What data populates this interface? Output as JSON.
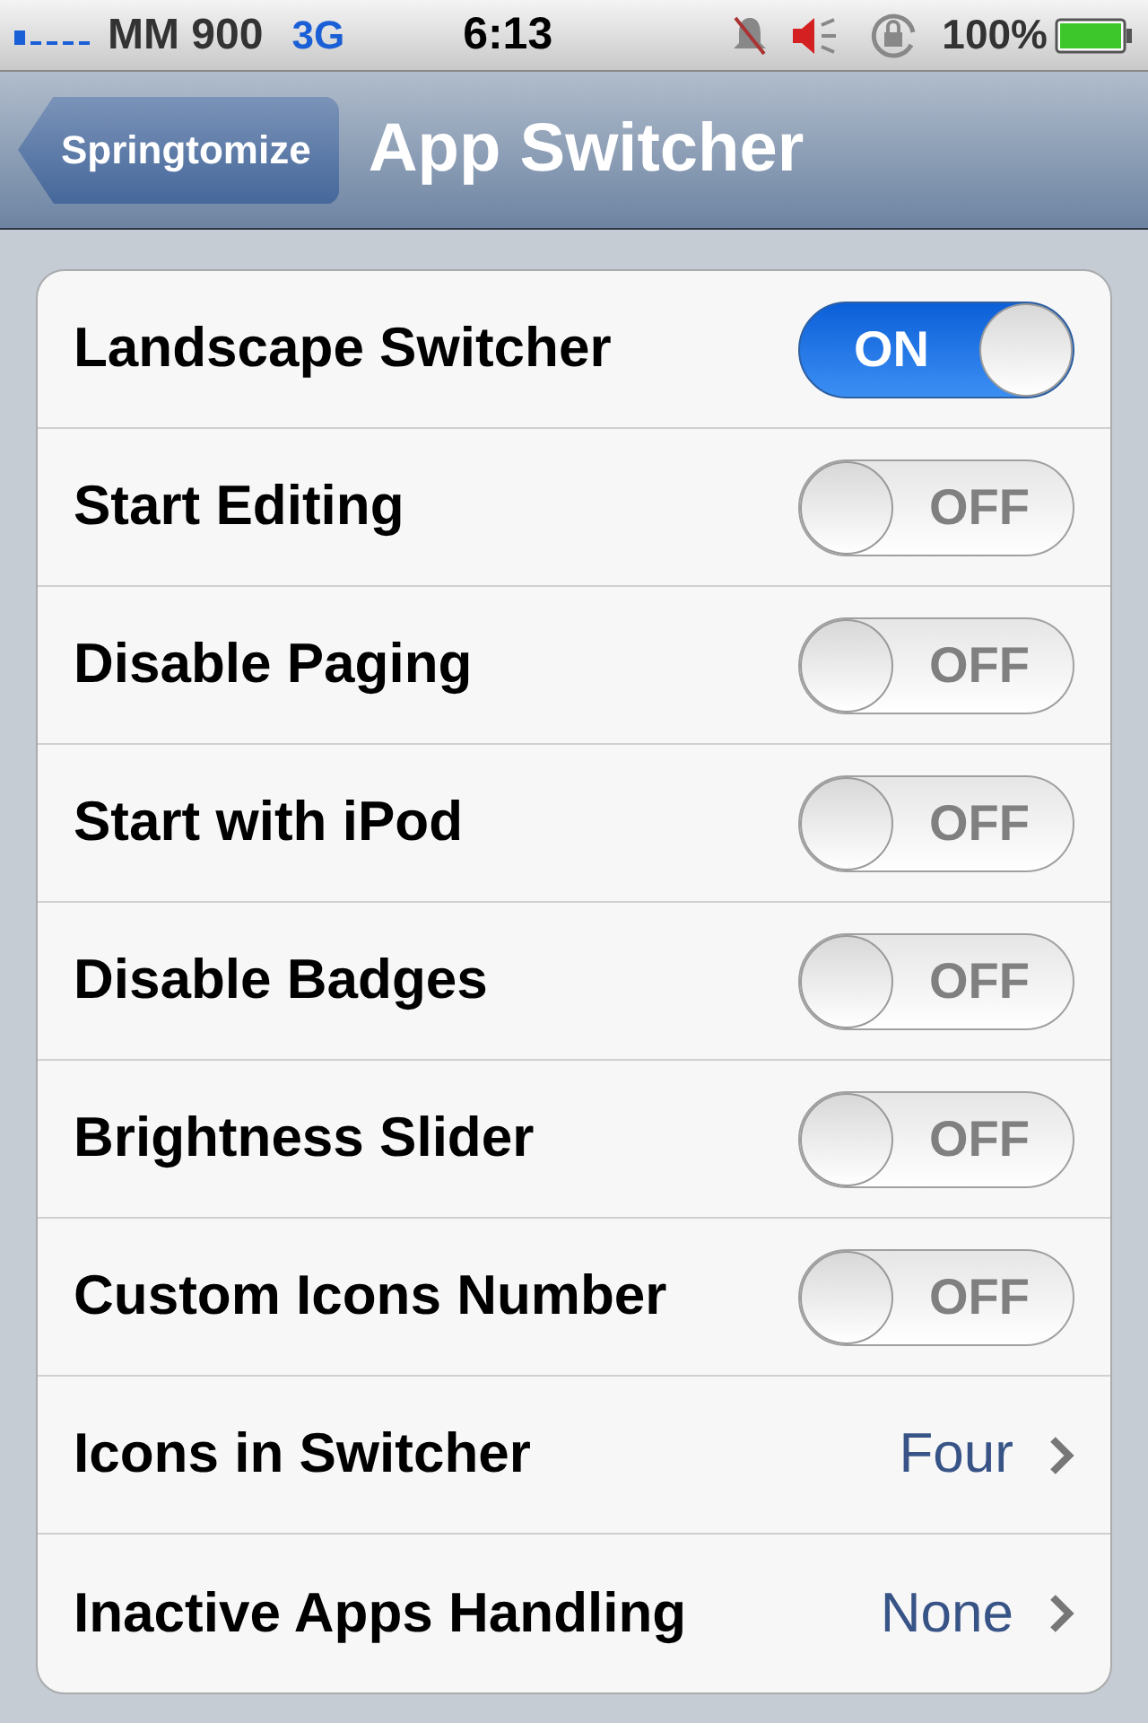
{
  "status_bar": {
    "carrier": "MM 900",
    "network": "3G",
    "time": "6:13",
    "battery": "100%"
  },
  "nav_bar": {
    "back": "Springtomize",
    "title": "App Switcher"
  },
  "rows": [
    {
      "kind": "switch",
      "label": "Landscape Switcher",
      "on": true,
      "switch_text": "ON"
    },
    {
      "kind": "switch",
      "label": "Start Editing",
      "on": false,
      "switch_text": "OFF"
    },
    {
      "kind": "switch",
      "label": "Disable Paging",
      "on": false,
      "switch_text": "OFF"
    },
    {
      "kind": "switch",
      "label": "Start with iPod",
      "on": false,
      "switch_text": "OFF"
    },
    {
      "kind": "switch",
      "label": "Disable Badges",
      "on": false,
      "switch_text": "OFF"
    },
    {
      "kind": "switch",
      "label": "Brightness Slider",
      "on": false,
      "switch_text": "OFF"
    },
    {
      "kind": "switch",
      "label": "Custom Icons Number",
      "on": false,
      "switch_text": "OFF"
    },
    {
      "kind": "disclosure",
      "label": "Icons in Switcher",
      "value": "Four"
    },
    {
      "kind": "disclosure",
      "label": "Inactive Apps Handling",
      "value": "None"
    }
  ]
}
